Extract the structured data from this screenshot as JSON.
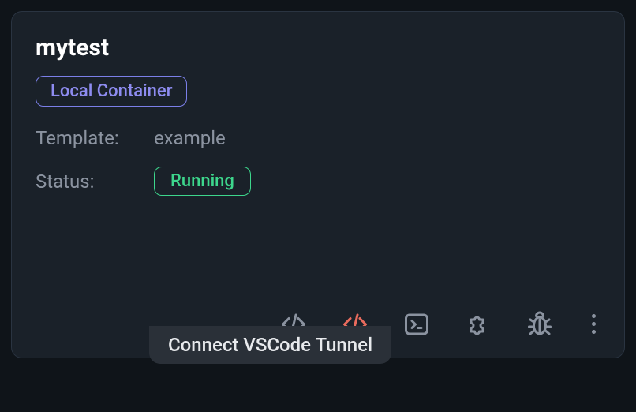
{
  "card": {
    "title": "mytest",
    "container_badge": "Local Container",
    "template_label": "Template:",
    "template_value": "example",
    "status_label": "Status:",
    "status_value": "Running"
  },
  "tooltip": "Connect VSCode Tunnel",
  "icons": {
    "code": "code-icon",
    "code_accent": "code-accent-icon",
    "terminal": "terminal-icon",
    "puzzle": "puzzle-icon",
    "bug": "bug-icon",
    "more": "more-icon"
  }
}
